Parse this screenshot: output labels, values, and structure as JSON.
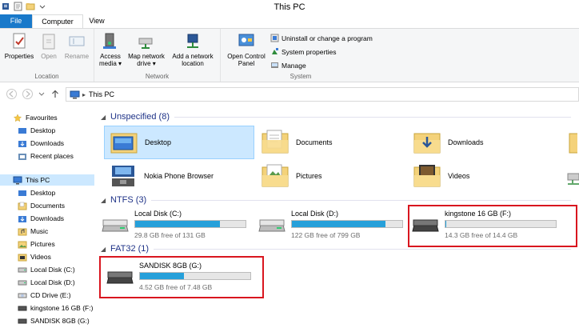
{
  "window": {
    "title": "This PC"
  },
  "tabs": {
    "file": "File",
    "computer": "Computer",
    "view": "View"
  },
  "ribbon": {
    "location": {
      "label": "Location",
      "properties": "Properties",
      "open": "Open",
      "rename": "Rename"
    },
    "network": {
      "label": "Network",
      "access_media": "Access media ▾",
      "map_drive": "Map network drive ▾",
      "add_location": "Add a network location"
    },
    "system": {
      "label": "System",
      "open_control_panel": "Open Control Panel",
      "uninstall": "Uninstall or change a program",
      "system_properties": "System properties",
      "manage": "Manage"
    }
  },
  "address": {
    "path": "This PC"
  },
  "nav": {
    "favourites": "Favourites",
    "fav_items": [
      "Desktop",
      "Downloads",
      "Recent places"
    ],
    "this_pc": "This PC",
    "pc_items": [
      "Desktop",
      "Documents",
      "Downloads",
      "Music",
      "Pictures",
      "Videos",
      "Local Disk (C:)",
      "Local Disk (D:)",
      "CD Drive (E:)",
      "kingstone 16 GB (F:)",
      "SANDISK 8GB (G:)"
    ]
  },
  "sections": {
    "unspecified": "Unspecified (8)",
    "ntfs": "NTFS (3)",
    "fat32": "FAT32 (1)"
  },
  "folders": [
    "Desktop",
    "Documents",
    "Downloads",
    "Nokia Phone Browser",
    "Pictures",
    "Videos"
  ],
  "drives": {
    "c": {
      "name": "Local Disk (C:)",
      "free": "29.8 GB free of 131 GB",
      "used_fraction": 0.77
    },
    "d": {
      "name": "Local Disk (D:)",
      "free": "122 GB free of 799 GB",
      "used_fraction": 0.85
    },
    "f": {
      "name": "kingstone 16 GB (F:)",
      "free": "14.3 GB free of 14.4 GB",
      "used_fraction": 0.01
    },
    "g": {
      "name": "SANDISK 8GB (G:)",
      "free": "4.52 GB free of 7.48 GB",
      "used_fraction": 0.4
    }
  },
  "colors": {
    "accent": "#1979ca",
    "bar_fill": "#26a0da",
    "highlight": "#d9161f",
    "section_text": "#1e3287"
  }
}
